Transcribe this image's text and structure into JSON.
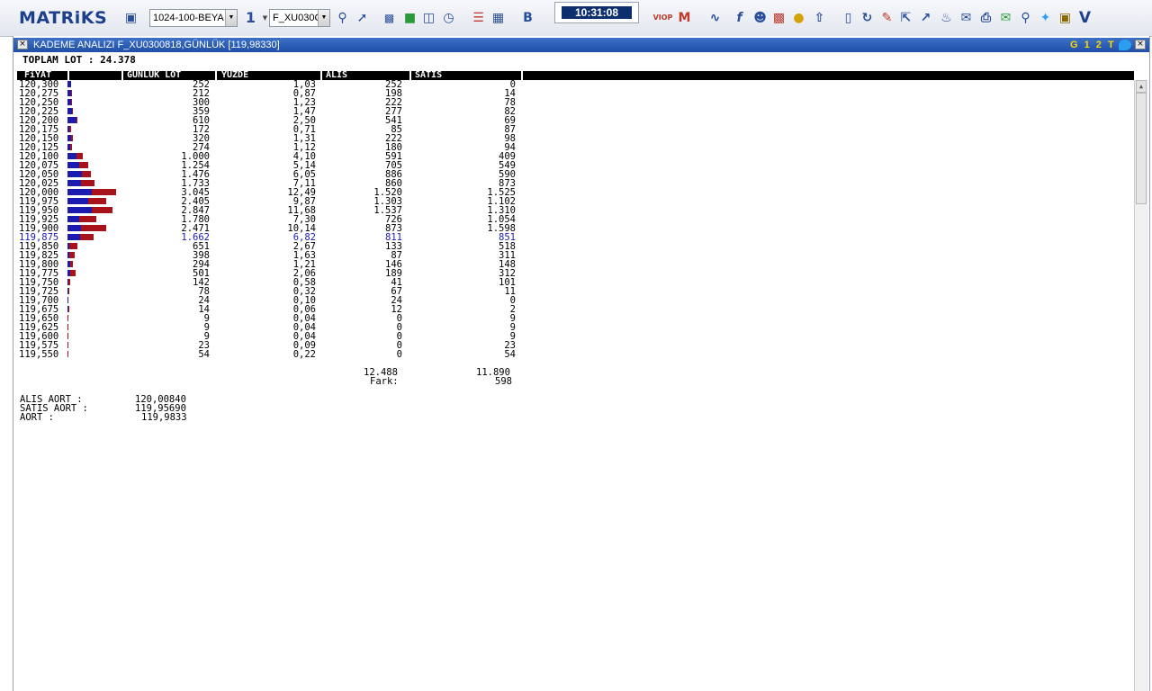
{
  "toolbar": {
    "logo": "MATRiKS",
    "template_combo": "1024-100-BEYA",
    "page_combo": "1",
    "symbol_combo": "F_XU030C",
    "bold_label": "B",
    "viop_label": "VIOP",
    "v_label": "V",
    "clock": "10:31:08"
  },
  "window": {
    "title": "KADEME ANALIZI F_XU0300818,GÜNLÜK [119,98330]",
    "flags": "G 1 2 T S",
    "total_lot_label": "TOPLAM LOT : 24.378"
  },
  "table": {
    "headers": {
      "price": "FiYAT",
      "lot": "GUNLUK LOT",
      "pct": "YUZDE",
      "buy": "ALIS",
      "sell": "SATIS"
    },
    "rows": [
      {
        "price": "120,300",
        "lot": "252",
        "pct": "1,03",
        "buy": "252",
        "sell": "0",
        "buyv": 252,
        "sellv": 0
      },
      {
        "price": "120,275",
        "lot": "212",
        "pct": "0,87",
        "buy": "198",
        "sell": "14",
        "buyv": 198,
        "sellv": 14
      },
      {
        "price": "120,250",
        "lot": "300",
        "pct": "1,23",
        "buy": "222",
        "sell": "78",
        "buyv": 222,
        "sellv": 78
      },
      {
        "price": "120,225",
        "lot": "359",
        "pct": "1,47",
        "buy": "277",
        "sell": "82",
        "buyv": 277,
        "sellv": 82
      },
      {
        "price": "120,200",
        "lot": "610",
        "pct": "2,50",
        "buy": "541",
        "sell": "69",
        "buyv": 541,
        "sellv": 69
      },
      {
        "price": "120,175",
        "lot": "172",
        "pct": "0,71",
        "buy": "85",
        "sell": "87",
        "buyv": 85,
        "sellv": 87
      },
      {
        "price": "120,150",
        "lot": "320",
        "pct": "1,31",
        "buy": "222",
        "sell": "98",
        "buyv": 222,
        "sellv": 98
      },
      {
        "price": "120,125",
        "lot": "274",
        "pct": "1,12",
        "buy": "180",
        "sell": "94",
        "buyv": 180,
        "sellv": 94
      },
      {
        "price": "120,100",
        "lot": "1.000",
        "pct": "4,10",
        "buy": "591",
        "sell": "409",
        "buyv": 591,
        "sellv": 409
      },
      {
        "price": "120,075",
        "lot": "1.254",
        "pct": "5,14",
        "buy": "705",
        "sell": "549",
        "buyv": 705,
        "sellv": 549
      },
      {
        "price": "120,050",
        "lot": "1.476",
        "pct": "6,05",
        "buy": "886",
        "sell": "590",
        "buyv": 886,
        "sellv": 590
      },
      {
        "price": "120,025",
        "lot": "1.733",
        "pct": "7,11",
        "buy": "860",
        "sell": "873",
        "buyv": 860,
        "sellv": 873
      },
      {
        "price": "120,000",
        "lot": "3.045",
        "pct": "12,49",
        "buy": "1.520",
        "sell": "1.525",
        "buyv": 1520,
        "sellv": 1525
      },
      {
        "price": "119,975",
        "lot": "2.405",
        "pct": "9,87",
        "buy": "1.303",
        "sell": "1.102",
        "buyv": 1303,
        "sellv": 1102
      },
      {
        "price": "119,950",
        "lot": "2.847",
        "pct": "11,68",
        "buy": "1.537",
        "sell": "1.310",
        "buyv": 1537,
        "sellv": 1310
      },
      {
        "price": "119,925",
        "lot": "1.780",
        "pct": "7,30",
        "buy": "726",
        "sell": "1.054",
        "buyv": 726,
        "sellv": 1054
      },
      {
        "price": "119,900",
        "lot": "2.471",
        "pct": "10,14",
        "buy": "873",
        "sell": "1.598",
        "buyv": 873,
        "sellv": 1598
      },
      {
        "price": "119,875",
        "lot": "1.662",
        "pct": "6,82",
        "buy": "811",
        "sell": "851",
        "buyv": 811,
        "sellv": 851,
        "highlight": true
      },
      {
        "price": "119,850",
        "lot": "651",
        "pct": "2,67",
        "buy": "133",
        "sell": "518",
        "buyv": 133,
        "sellv": 518
      },
      {
        "price": "119,825",
        "lot": "398",
        "pct": "1,63",
        "buy": "87",
        "sell": "311",
        "buyv": 87,
        "sellv": 311
      },
      {
        "price": "119,800",
        "lot": "294",
        "pct": "1,21",
        "buy": "146",
        "sell": "148",
        "buyv": 146,
        "sellv": 148
      },
      {
        "price": "119,775",
        "lot": "501",
        "pct": "2,06",
        "buy": "189",
        "sell": "312",
        "buyv": 189,
        "sellv": 312
      },
      {
        "price": "119,750",
        "lot": "142",
        "pct": "0,58",
        "buy": "41",
        "sell": "101",
        "buyv": 41,
        "sellv": 101
      },
      {
        "price": "119,725",
        "lot": "78",
        "pct": "0,32",
        "buy": "67",
        "sell": "11",
        "buyv": 67,
        "sellv": 11
      },
      {
        "price": "119,700",
        "lot": "24",
        "pct": "0,10",
        "buy": "24",
        "sell": "0",
        "buyv": 24,
        "sellv": 0
      },
      {
        "price": "119,675",
        "lot": "14",
        "pct": "0,06",
        "buy": "12",
        "sell": "2",
        "buyv": 12,
        "sellv": 2
      },
      {
        "price": "119,650",
        "lot": "9",
        "pct": "0,04",
        "buy": "0",
        "sell": "9",
        "buyv": 0,
        "sellv": 9
      },
      {
        "price": "119,625",
        "lot": "9",
        "pct": "0,04",
        "buy": "0",
        "sell": "9",
        "buyv": 0,
        "sellv": 9
      },
      {
        "price": "119,600",
        "lot": "9",
        "pct": "0,04",
        "buy": "0",
        "sell": "9",
        "buyv": 0,
        "sellv": 9
      },
      {
        "price": "119,575",
        "lot": "23",
        "pct": "0,09",
        "buy": "0",
        "sell": "23",
        "buyv": 0,
        "sellv": 23
      },
      {
        "price": "119,550",
        "lot": "54",
        "pct": "0,22",
        "buy": "0",
        "sell": "54",
        "buyv": 0,
        "sellv": 54
      }
    ],
    "bar_scale_max": 3045
  },
  "totals": {
    "buy_total": "12.488",
    "sell_total": "11.890",
    "diff_label": "Fark:",
    "diff_value": "598"
  },
  "averages": {
    "buy_label": "ALIS AORT :",
    "buy_value": "120,00840",
    "sell_label": "SATIS AORT :",
    "sell_value": "119,95690",
    "avg_label": "AORT :",
    "avg_value": "119,9833"
  },
  "colors": {
    "buy": "#1b1bb0",
    "sell": "#a8131b",
    "title": "#1f4fa6",
    "highlight": "#1a1ab8"
  }
}
